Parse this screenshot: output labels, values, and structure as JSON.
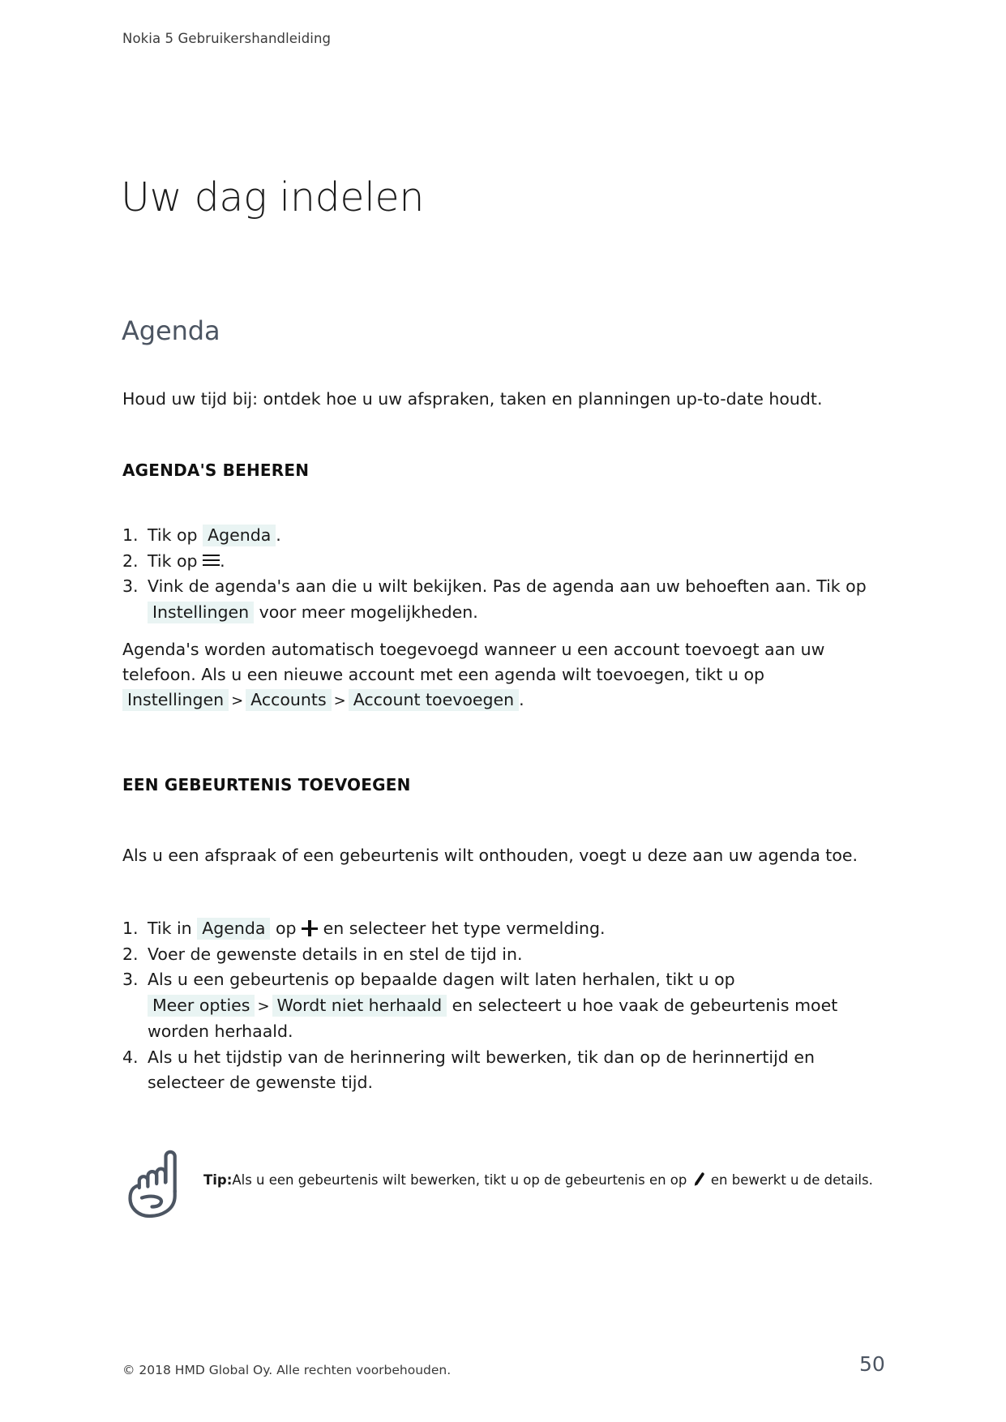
{
  "document": {
    "running_header": "Nokia 5 Gebruikershandleiding",
    "chapter_title": "Uw dag indelen",
    "section_title": "Agenda",
    "intro": "Houd uw tijd bij: ontdek hoe u uw afspraken, taken en planningen up-to-date houdt."
  },
  "manage_calendars": {
    "heading": "AGENDA'S BEHEREN",
    "step1": {
      "num": "1.",
      "before": "Tik op",
      "ui": "Agenda",
      "after": "."
    },
    "step2": {
      "num": "2.",
      "before": "Tik op",
      "icon": "hamburger-menu-icon",
      "after": "."
    },
    "step3": {
      "num": "3.",
      "before": "Vink de agenda's aan die u wilt bekijken. Pas de agenda aan uw behoeften aan. Tik op",
      "ui": "Instellingen",
      "after": "voor meer mogelijkheden."
    },
    "paragraph": "Agenda's worden automatisch toegevoegd wanneer u een account toevoegt aan uw telefoon. Als u een nieuwe account met een agenda wilt toevoegen, tikt u op",
    "path": {
      "item1": "Instellingen",
      "sep1": ">",
      "item2": "Accounts",
      "sep2": ">",
      "item3": "Account toevoegen",
      "end": "."
    }
  },
  "add_event": {
    "heading": "EEN GEBEURTENIS TOEVOEGEN",
    "intro": "Als u een afspraak of een gebeurtenis wilt onthouden, voegt u deze aan uw agenda toe.",
    "step1": {
      "num": "1.",
      "before": "Tik in",
      "ui": "Agenda",
      "middle": "op",
      "icon": "plus-icon",
      "after": "en selecteer het type vermelding."
    },
    "step2": {
      "num": "2.",
      "text": "Voer de gewenste details in en stel de tijd in."
    },
    "step3": {
      "num": "3.",
      "before": "Als u een gebeurtenis op bepaalde dagen wilt laten herhalen, tikt u op",
      "ui1": "Meer opties",
      "sep": ">",
      "ui2": "Wordt niet herhaald",
      "after": "en selecteert u hoe vaak de gebeurtenis moet worden herhaald."
    },
    "step4": {
      "num": "4.",
      "text": "Als u het tijdstip van de herinnering wilt bewerken, tik dan op de herinnertijd en selecteer de gewenste tijd."
    }
  },
  "tip": {
    "icon": "pointing-hand-icon",
    "label": "Tip:",
    "before": "Als u een gebeurtenis wilt bewerken, tikt u op de gebeurtenis en op",
    "inline_icon": "pencil-edit-icon",
    "after": "en bewerkt u de details."
  },
  "footer": {
    "copyright": "© 2018 HMD Global Oy. Alle rechten voorbehouden.",
    "page_number": "50"
  },
  "colors": {
    "ui_term_background": "#e9f4f3",
    "heading_slate": "#4c5562",
    "body_text": "#1a1a1a"
  }
}
